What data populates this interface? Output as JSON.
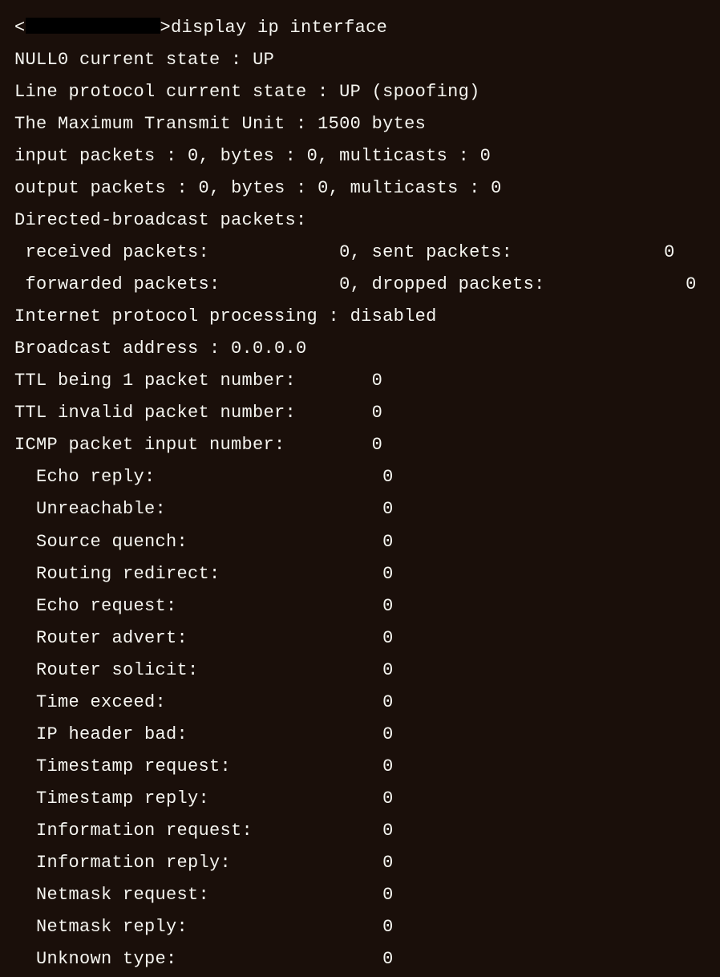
{
  "prompt": {
    "open": "<",
    "close": ">",
    "command": "display ip interface"
  },
  "interface": {
    "name": "NULL0",
    "currentState": "UP",
    "lineProtocolState": "UP (spoofing)",
    "mtu": "1500 bytes",
    "inputPackets": "0",
    "inputBytes": "0",
    "inputMulticasts": "0",
    "outputPackets": "0",
    "outputBytes": "0",
    "outputMulticasts": "0",
    "directedBroadcast": {
      "receivedPackets": "0",
      "sentPackets": "0",
      "forwardedPackets": "0",
      "droppedPackets": "0"
    },
    "ipProcessing": "disabled",
    "broadcastAddress": "0.0.0.0",
    "ttlBeing1": "0",
    "ttlInvalid": "0",
    "icmpInput": "0",
    "icmp": {
      "echoReply": "0",
      "unreachable": "0",
      "sourceQuench": "0",
      "routingRedirect": "0",
      "echoRequest": "0",
      "routerAdvert": "0",
      "routerSolicit": "0",
      "timeExceed": "0",
      "ipHeaderBad": "0",
      "timestampRequest": "0",
      "timestampReply": "0",
      "informationRequest": "0",
      "informationReply": "0",
      "netmaskRequest": "0",
      "netmaskReply": "0",
      "unknownType": "0"
    }
  }
}
